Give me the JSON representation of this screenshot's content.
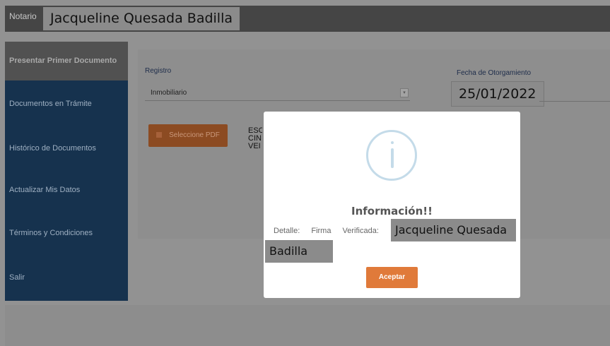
{
  "header": {
    "label": "Notario",
    "user_name": "Jacqueline Quesada Badilla"
  },
  "sidebar": {
    "items": [
      {
        "label": "Presentar Primer Documento"
      },
      {
        "label": "Documentos en Trámite"
      },
      {
        "label": "Histórico de Documentos"
      },
      {
        "label": "Actualizar Mis Datos"
      },
      {
        "label": "Términos y Condiciones"
      },
      {
        "label": "Salir"
      }
    ]
  },
  "form": {
    "registro_label": "Registro",
    "registro_value": "Inmobiliario",
    "fecha_label": "Fecha de Otorgamiento",
    "fecha_value": "25/01/2022",
    "pdf_button": "Seleccione PDF",
    "doc_text_lines": [
      "ESC",
      "CIN",
      "VEI"
    ]
  },
  "modal": {
    "title": "Información!!",
    "detail_label": "Detalle:",
    "firma_label": "Firma",
    "verificada_label": "Verificada:",
    "name_line1": "Jacqueline Quesada",
    "name_line2": "Badilla",
    "accept_button": "Aceptar"
  }
}
